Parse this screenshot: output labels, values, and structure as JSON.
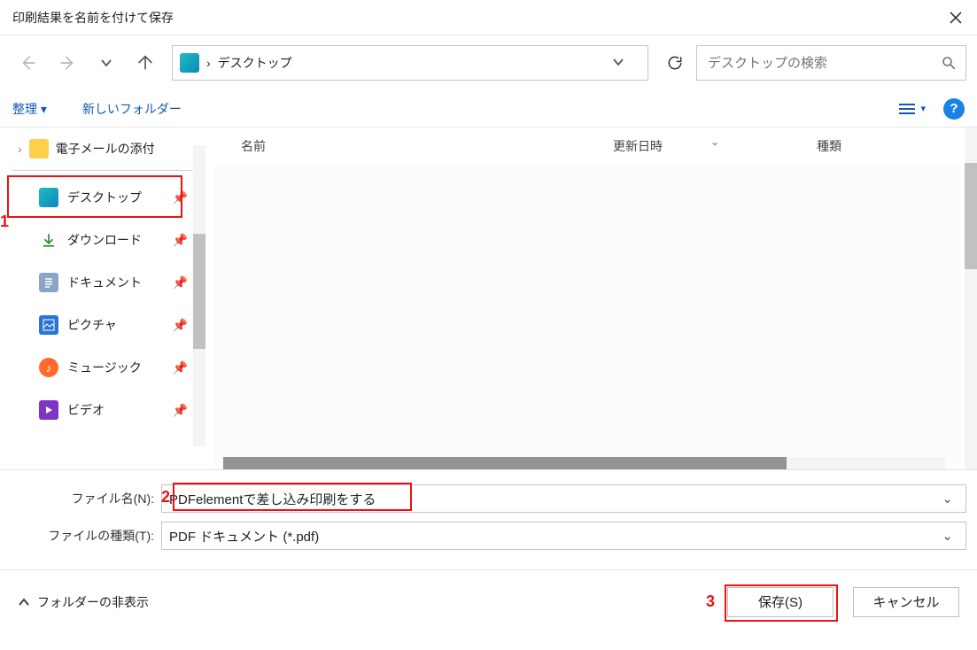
{
  "window": {
    "title": "印刷結果を名前を付けて保存"
  },
  "breadcrumb": {
    "location": "デスクトップ",
    "sep": "›"
  },
  "search": {
    "placeholder": "デスクトップの検索"
  },
  "toolbar": {
    "organize": "整理 ▾",
    "new_folder": "新しいフォルダー",
    "help": "?"
  },
  "tree": {
    "top_item": "電子メールの添付",
    "chevron": "›"
  },
  "nav_items": [
    {
      "label": "デスクトップ"
    },
    {
      "label": "ダウンロード"
    },
    {
      "label": "ドキュメント"
    },
    {
      "label": "ピクチャ"
    },
    {
      "label": "ミュージック"
    },
    {
      "label": "ビデオ"
    }
  ],
  "columns": {
    "name": "名前",
    "date": "更新日時",
    "type": "種類"
  },
  "fields": {
    "filename_label": "ファイル名(N):",
    "filename_value": "PDFelementで差し込み印刷をする",
    "filetype_label": "ファイルの種類(T):",
    "filetype_value": "PDF ドキュメント (*.pdf)"
  },
  "footer": {
    "hide_folders": "フォルダーの非表示",
    "save": "保存(S)",
    "cancel": "キャンセル"
  },
  "annotations": {
    "n1": "1",
    "n2": "2",
    "n3": "3"
  }
}
